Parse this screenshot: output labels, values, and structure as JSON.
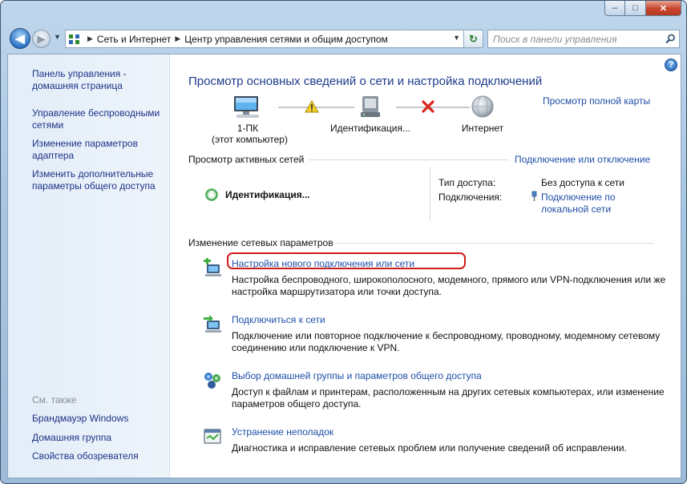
{
  "titlebar": {
    "minimize_label": "–",
    "maximize_label": "□",
    "close_label": "✕"
  },
  "nav": {
    "back_icon": "arrow-left-icon",
    "breadcrumbs": [
      "Сеть и Интернет",
      "Центр управления сетями и общим доступом"
    ],
    "search": {
      "placeholder": "Поиск в панели управления"
    }
  },
  "sidebar": {
    "home": "Панель управления - домашняя страница",
    "items": [
      "Управление беспроводными сетями",
      "Изменение параметров адаптера",
      "Изменить дополнительные параметры общего доступа"
    ],
    "see_also_title": "См. также",
    "see_also": [
      "Брандмауэр Windows",
      "Домашняя группа",
      "Свойства обозревателя"
    ]
  },
  "main": {
    "title": "Просмотр основных сведений о сети и настройка подключений",
    "full_map_link": "Просмотр полной карты",
    "map": {
      "nodes": [
        {
          "label": "1-ПК",
          "sublabel": "(этот компьютер)"
        },
        {
          "label": "Идентификация..."
        },
        {
          "label": "Интернет"
        }
      ]
    },
    "active": {
      "header": "Просмотр активных сетей",
      "connect_link": "Подключение или отключение",
      "network_name": "Идентификация...",
      "access_type_label": "Тип доступа:",
      "access_type_value": "Без доступа к сети",
      "connections_label": "Подключения:",
      "connections_value_line1": "Подключение по",
      "connections_value_line2": "локальной сети"
    },
    "change": {
      "header": "Изменение сетевых параметров",
      "tasks": [
        {
          "icon": "new-connection-icon",
          "title": "Настройка нового подключения или сети",
          "desc": "Настройка беспроводного, широкополосного, модемного, прямого или VPN-подключения или же настройка маршрутизатора или точки доступа."
        },
        {
          "icon": "connect-network-icon",
          "title": "Подключиться к сети",
          "desc": "Подключение или повторное подключение к беспроводному, проводному, модемному сетевому соединению или подключение к VPN."
        },
        {
          "icon": "homegroup-icon",
          "title": "Выбор домашней группы и параметров общего доступа",
          "desc": "Доступ к файлам и принтерам, расположенным на других сетевых компьютерах, или изменение параметров общего доступа."
        },
        {
          "icon": "troubleshoot-icon",
          "title": "Устранение неполадок",
          "desc": "Диагностика и исправление сетевых проблем или получение сведений об исправлении."
        }
      ]
    }
  },
  "colors": {
    "link": "#1f4ea7",
    "title": "#1e3b8c",
    "highlight": "#d11a1a"
  }
}
